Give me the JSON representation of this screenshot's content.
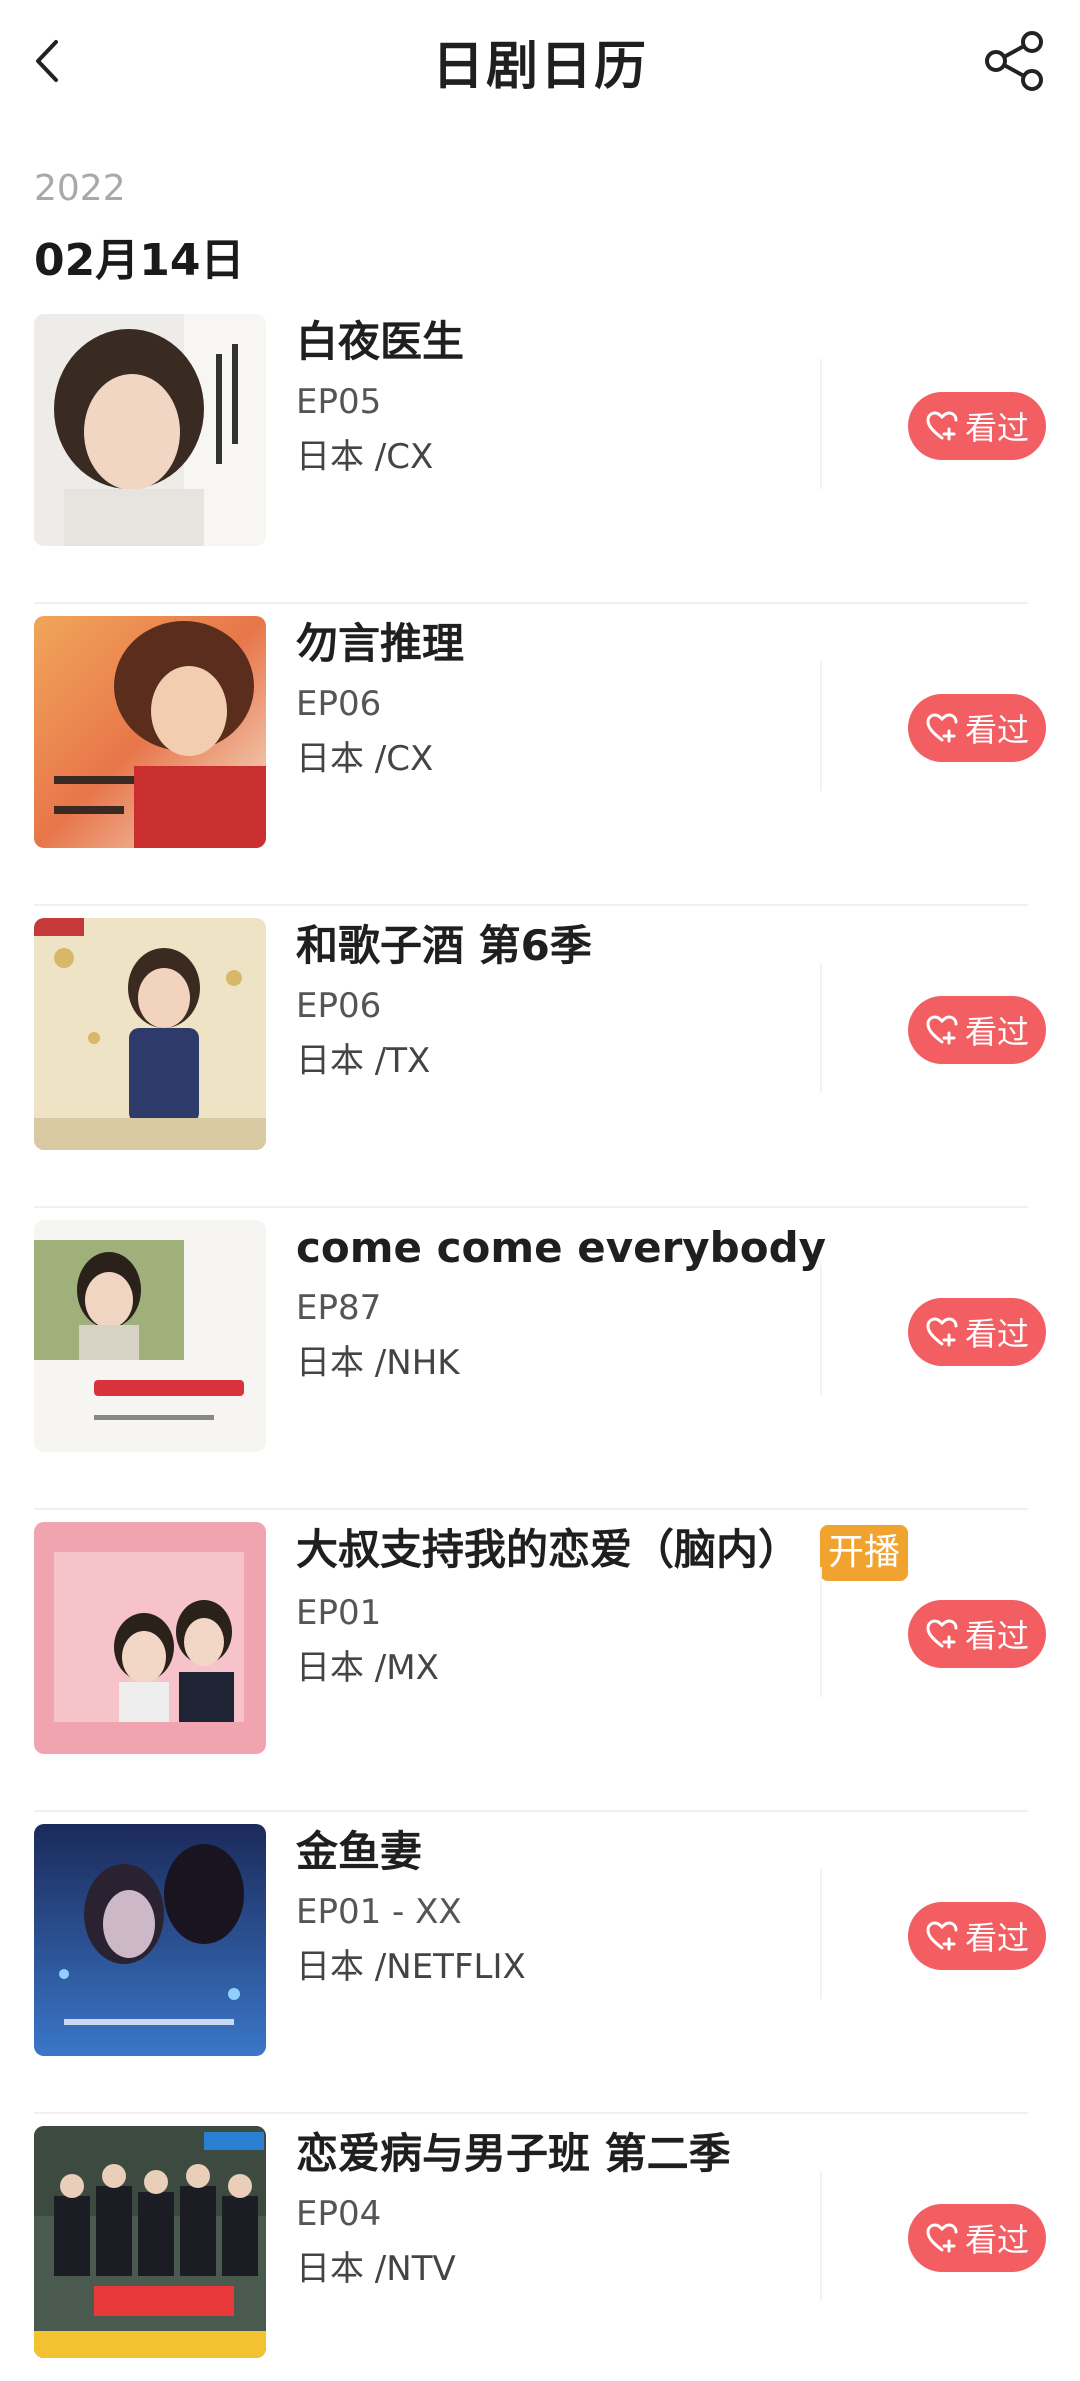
{
  "header": {
    "title": "日剧日历",
    "back_icon": "chevron-left-icon",
    "share_icon": "share-icon"
  },
  "date_section": {
    "year": "2022",
    "date": "02月14日"
  },
  "colors": {
    "watched_button": "#f25e62",
    "premiere_badge": "#f0a32e"
  },
  "shows": [
    {
      "title": "白夜医生",
      "episode": "EP05",
      "network": "日本 /CX",
      "button": "看过",
      "badge": ""
    },
    {
      "title": "勿言推理",
      "episode": "EP06",
      "network": "日本 /CX",
      "button": "看过",
      "badge": ""
    },
    {
      "title": "和歌子酒 第6季",
      "episode": "EP06",
      "network": "日本 /TX",
      "button": "看过",
      "badge": ""
    },
    {
      "title": "come come everybody",
      "episode": "EP87",
      "network": "日本 /NHK",
      "button": "看过",
      "badge": ""
    },
    {
      "title": "大叔支持我的恋爱（脑内）",
      "episode": "EP01",
      "network": "日本 /MX",
      "button": "看过",
      "badge": "开播"
    },
    {
      "title": "金鱼妻",
      "episode": "EP01 - XX",
      "network": "日本 /NETFLIX",
      "button": "看过",
      "badge": ""
    },
    {
      "title": "恋爱病与男子班 第二季",
      "episode": "EP04",
      "network": "日本 /NTV",
      "button": "看过",
      "badge": ""
    }
  ]
}
